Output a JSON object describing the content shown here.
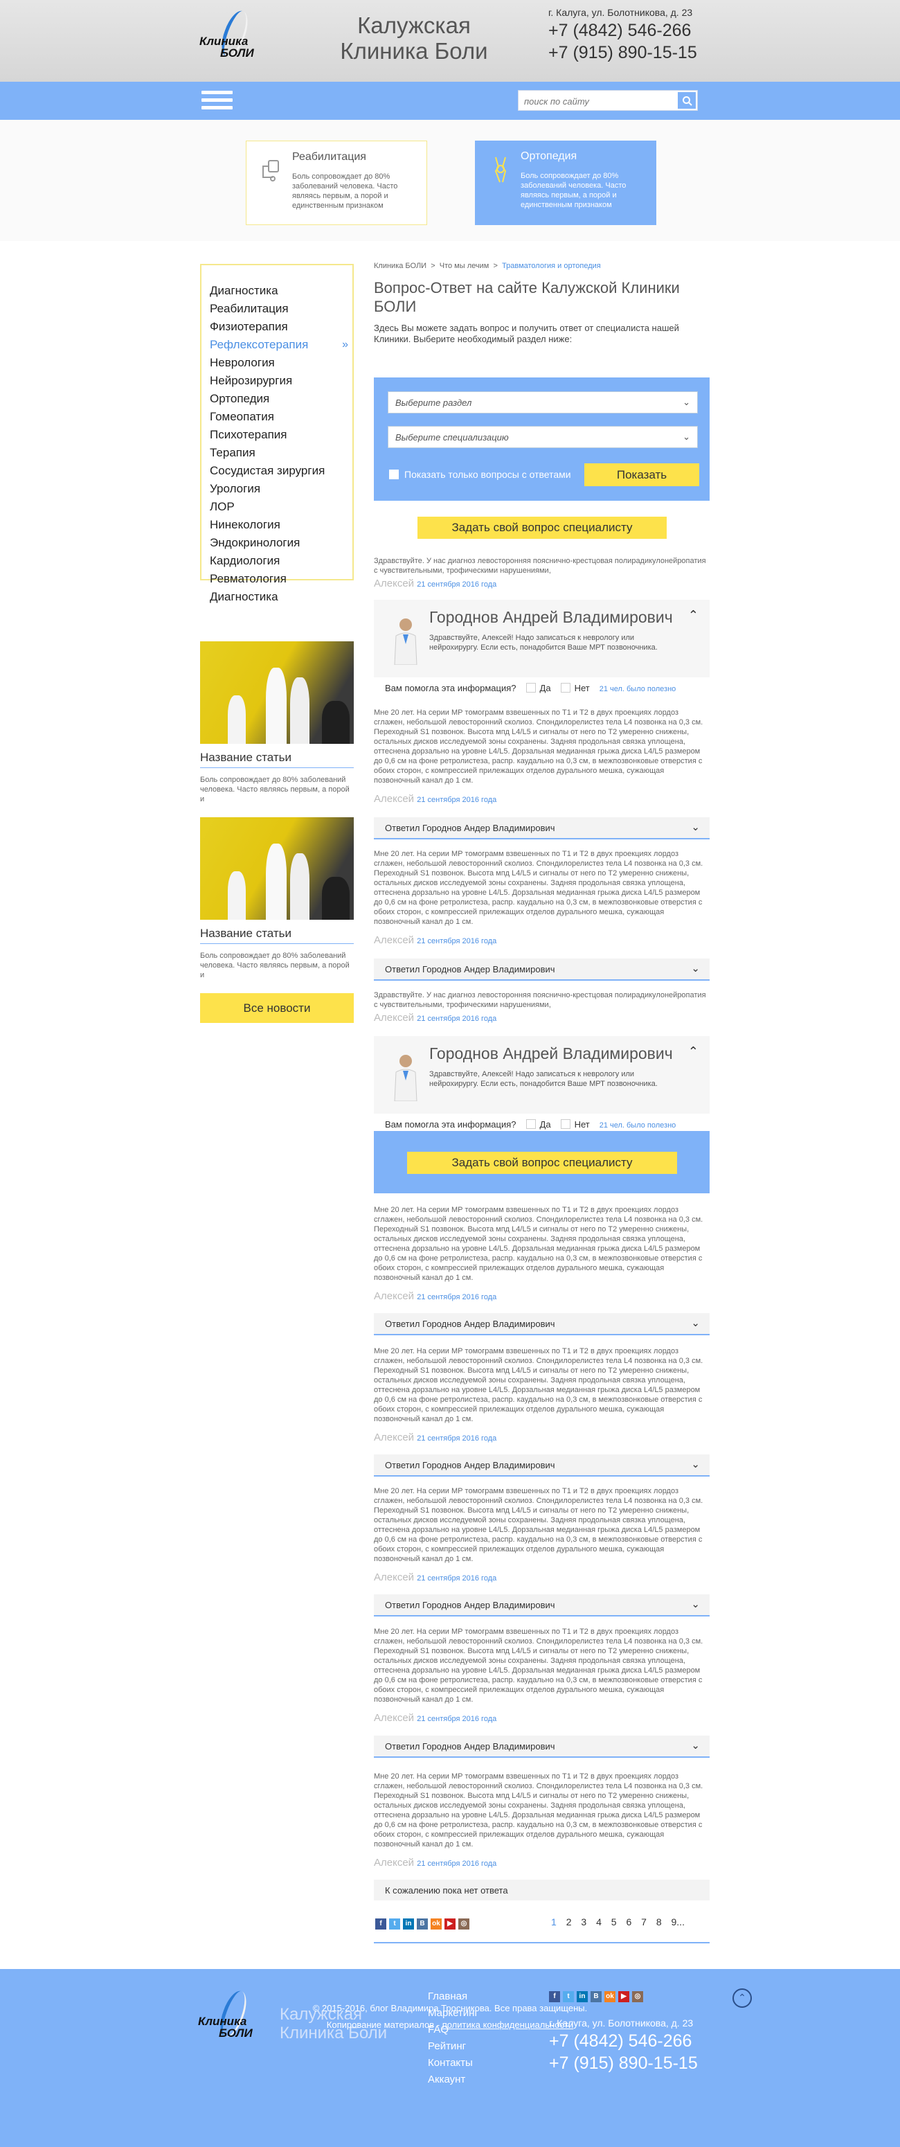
{
  "header": {
    "logo_line1": "Клиника",
    "logo_line2": "БОЛИ",
    "brand_line1": "Калужская",
    "brand_line2": "Клиника Боли",
    "address": "г. Калуга, ул. Болотникова, д. 23",
    "phone1": "+7 (4842) 546-266",
    "phone2": "+7 (915) 890-15-15"
  },
  "search": {
    "placeholder": "поиск по сайту"
  },
  "promo": [
    {
      "title": "Реабилитация",
      "text": "Боль сопровождает до 80% заболеваний человека. Часто являясь первым, а порой и единственным признаком"
    },
    {
      "title": "Ортопедия",
      "text": "Боль сопровождает до 80% заболеваний человека. Часто являясь первым, а порой и единственным признаком"
    }
  ],
  "sidebar": {
    "items": [
      "Диагностика",
      "Реабилитация",
      "Физиотерапия",
      "Рефлексотерапия",
      "Неврология",
      "Нейрозирургия",
      "Ортопедия",
      "Гомеопатия",
      "Психотерапия",
      "Терапия",
      "Сосудистая зирургия",
      "Урология",
      "ЛОР",
      "Нинекология",
      "Эндокринология",
      "Кардиология",
      "Ревматология",
      "Диагностика"
    ],
    "active_index": 3
  },
  "news": [
    {
      "title": "Название статьи",
      "text": "Боль сопровождает до 80% заболеваний человека. Часто являясь первым, а порой и"
    },
    {
      "title": "Название статьи",
      "text": "Боль сопровождает до 80% заболеваний человека. Часто являясь первым, а порой и"
    }
  ],
  "all_news": "Все новости",
  "breadcrumb": {
    "c1": "Клиника БОЛИ",
    "sep": ">",
    "c2": "Что мы лечим",
    "c3": "Травматология и ортопедия"
  },
  "page_title": "Вопрос-Ответ на сайте Калужской Клиники БОЛИ",
  "intro": "Здесь Вы можете задать вопрос и получить ответ от специалиста нашей Клиники. Выберите необходимый раздел ниже:",
  "filter": {
    "section_placeholder": "Выберите раздел",
    "spec_placeholder": "Выберите специализацию",
    "only_answered": "Показать только вопросы с ответами",
    "show_button": "Показать"
  },
  "ask_button": "Задать свой вопрос  специалисту",
  "short_q": "Здравствуйте. У нас диагноз левосторонняя пояснично-крестцовая полирадикулонейропатия с чувствительными, трофическими нарушениями,",
  "long_q": "Мне 20 лет. На серии МР томограмм взвешенных по Т1 и Т2 в двух проекциях лордоз сглажен, небольшой левосторонний сколиоз. Спондилорелистез тела L4 позвонка на 0,3 см. Переходный S1 позвонок. Высота мпд L4/L5 и сигналы от него по Т2 умеренно снижены, остальных дисков исследуемой зоны сохранены. Задняя продольная связка уплощена, оттеснена дорзально на уровне L4/L5. Дорзальная медианная грыжа диска L4/L5 размером до 0,6 см на фоне ретролистеза, распр. каудально на 0,3 см, в межпозвонковые отверстия с обоих сторон, с компрессией прилежащих отделов дурального мешка, сужающая позвоночный канал до 1 см.",
  "author": "Алексей",
  "date": "21 сентября 2016 года",
  "doctor": {
    "name": "Городнов Андрей Владимирович",
    "answer": "Здравствуйте, Алексей! Надо записаться к неврологу или нейрохирургу. Если есть, понадобится Ваше МРТ позвоночника."
  },
  "helpful": {
    "question": "Вам помогла эта информация?",
    "yes": "Да",
    "no": "Нет",
    "count": "21 чел. было полезно"
  },
  "answered_bar": "Ответил Городнов Андер   Владимирович",
  "no_answer": "К сожалению пока нет ответа",
  "pagination": [
    "1",
    "2",
    "3",
    "4",
    "5",
    "6",
    "7",
    "8",
    "9..."
  ],
  "social_icons": [
    "facebook-icon",
    "twitter-icon",
    "linkedin-icon",
    "vk-icon",
    "odnoklassniki-icon",
    "youtube-icon",
    "instagram-icon"
  ],
  "footer": {
    "links": [
      "Главная",
      "Маркетинг",
      "FAQ",
      "Рейтинг",
      "Контакты",
      "Аккаунт"
    ],
    "copyright": "© 2015-2016, блог Владимира Тросникова. Все права защищены.",
    "copying_prefix": "Копирование материалов - ",
    "privacy_link": "политика конфиденциальности"
  },
  "colors": {
    "accent": "#7fb2f8",
    "yellow": "#fde24b",
    "link": "#4b8fe3"
  }
}
